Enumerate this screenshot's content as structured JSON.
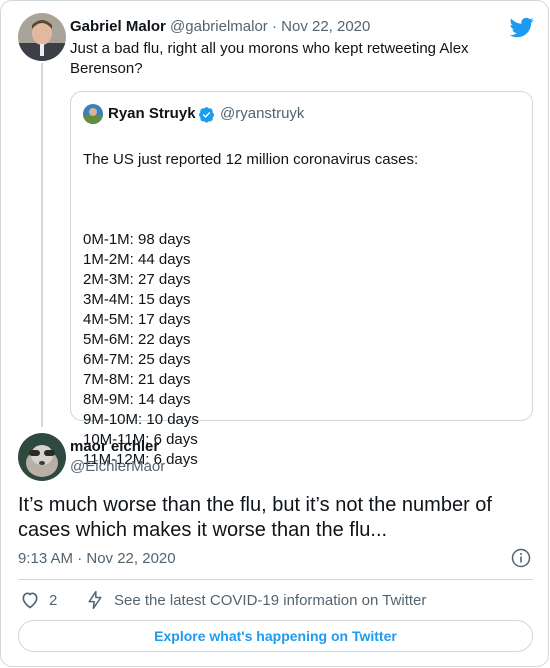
{
  "parent_tweet": {
    "name": "Gabriel Malor",
    "handle": "@gabrielmalor",
    "separator": " · ",
    "date": "Nov 22, 2020",
    "text": "Just a bad flu, right all you morons who kept retweeting Alex\nBerenson?",
    "quoted": {
      "name": "Ryan Struyk",
      "handle": "@ryanstruyk",
      "intro": "The US just reported 12 million coronavirus cases:",
      "rows": [
        "0M-1M: 98 days",
        "1M-2M: 44 days",
        "2M-3M: 27 days",
        "3M-4M: 15 days",
        "4M-5M: 17 days",
        "5M-6M: 22 days",
        "6M-7M: 25 days",
        "7M-8M: 21 days",
        "8M-9M: 14 days",
        "9M-10M: 10 days",
        "10M-11M: 6 days",
        "11M-12M: 6 days"
      ]
    }
  },
  "main_tweet": {
    "name": "maor eichler",
    "handle": "@EichlerMaor",
    "text": "It’s much worse than the flu, but it’s not the number of cases which makes it worse than the flu...",
    "timestamp": "9:13 AM · Nov 22, 2020"
  },
  "actions": {
    "like_count": "2",
    "covid_link": "See the latest COVID-19 information on Twitter",
    "explore_label": "Explore what's happening on Twitter"
  },
  "colors": {
    "accent": "#1d9bf0",
    "secondary_text": "#536471",
    "border": "#cfd9de"
  },
  "icons": [
    "twitter-bird-icon",
    "verified-badge-icon",
    "info-icon",
    "heart-icon",
    "lightning-icon"
  ]
}
